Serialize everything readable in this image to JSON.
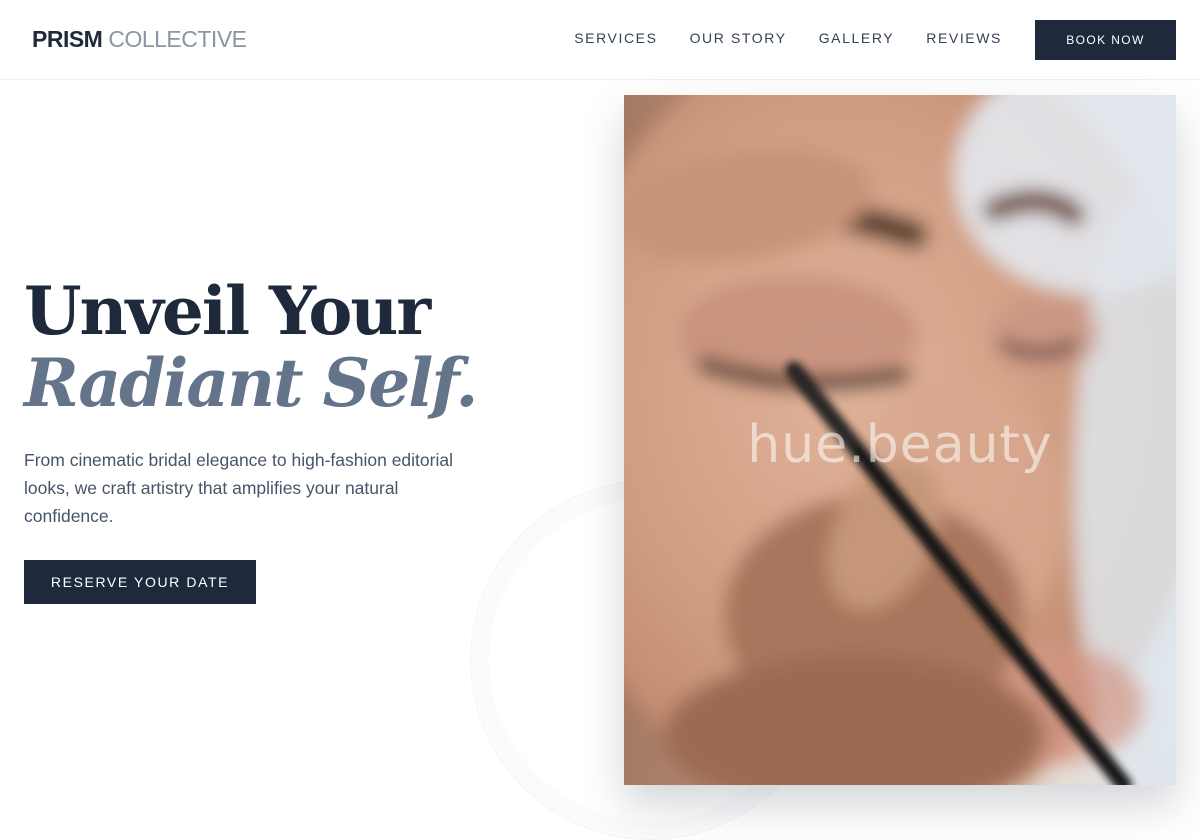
{
  "nav": {
    "brand_strong": "PRISM",
    "brand_light": "COLLECTIVE",
    "links": [
      "SERVICES",
      "OUR STORY",
      "GALLERY",
      "REVIEWS"
    ],
    "cta": "BOOK NOW"
  },
  "hero": {
    "title_line1": "Unveil Your",
    "title_line2": "Radiant Self.",
    "subtitle": "From cinematic bridal elegance to high-fashion editorial looks, we craft artistry that amplifies your natural confidence.",
    "cta": "RESERVE YOUR DATE"
  },
  "photo": {
    "watermark": "hue.beauty",
    "subject": "makeup-application-eyeliner"
  },
  "colors": {
    "primary": "#1e293b",
    "accent_muted": "#64748b",
    "brand_light": "#8a95a5",
    "body_text": "#475569"
  }
}
